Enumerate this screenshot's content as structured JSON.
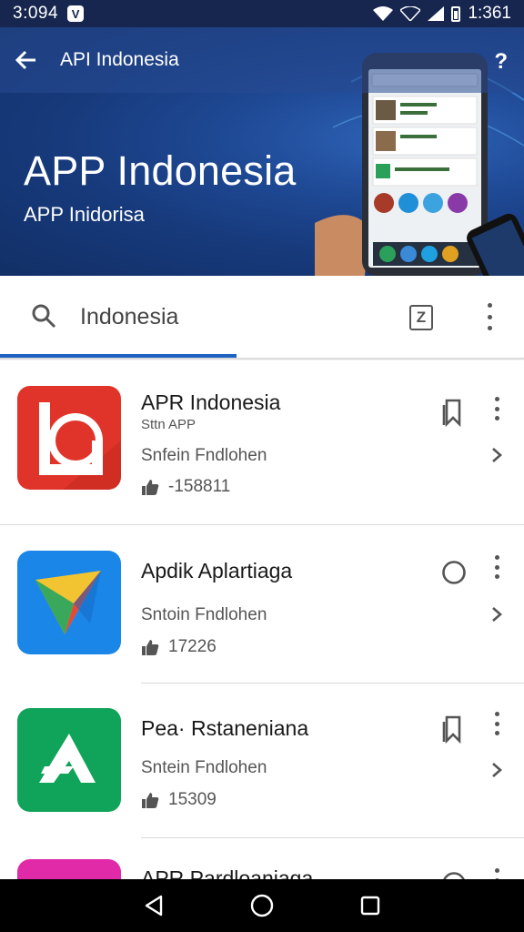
{
  "status_bar": {
    "time": "3:094",
    "app_badge": "V",
    "battery_text": "1:361"
  },
  "toolbar": {
    "title": "API Indonesia",
    "help_glyph": "?"
  },
  "hero": {
    "title": "APP Indonesia",
    "subtitle": "APP Inidorisa"
  },
  "search": {
    "query": "Indonesia",
    "z_label": "Z"
  },
  "apps": [
    {
      "name": "APR Indonesia",
      "sub": "Sttn APP",
      "developer": "Snfein Fndlohen",
      "count": "-158811",
      "action": "bookmark-icon",
      "icon_color": "#e0342a"
    },
    {
      "name": "Apdik Aplartiaga",
      "sub": "",
      "developer": "Sntoin Fndlohen",
      "count": "17226",
      "action": "circle-icon",
      "icon_color": "#1a86e8"
    },
    {
      "name": "Pea· Rstaneniana",
      "sub": "",
      "developer": "Sntein Fndlohen",
      "count": "15309",
      "action": "bookmark-icon",
      "icon_color": "#10a35a"
    },
    {
      "name": "APR Pardloaniaga",
      "sub": "",
      "developer": "",
      "count": "",
      "action": "circle-icon",
      "icon_color": "#e02aa8"
    }
  ],
  "colors": {
    "status_bar": "#16264f",
    "hero_dark": "#122f66",
    "accent": "#1e63c2"
  }
}
